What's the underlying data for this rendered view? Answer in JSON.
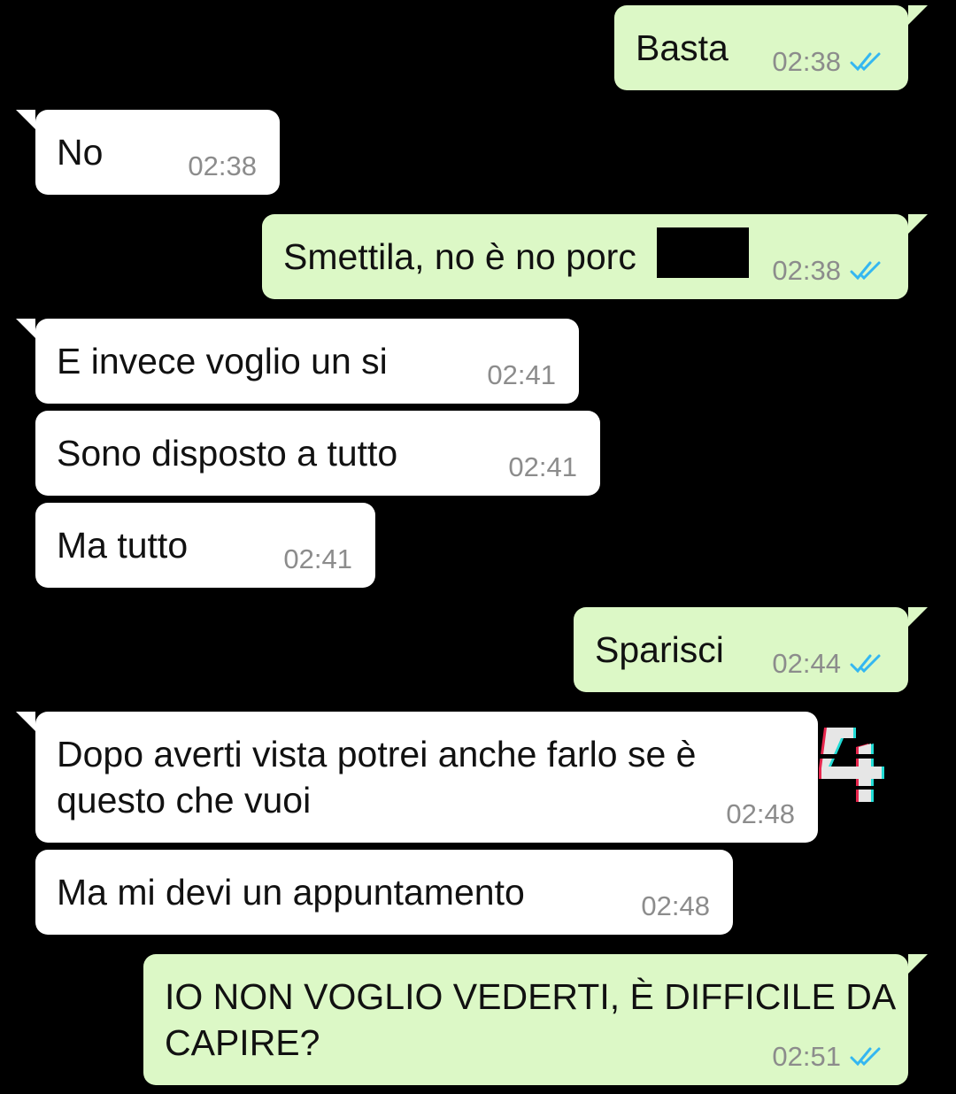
{
  "colors": {
    "background": "#000000",
    "outgoing_bubble": "#dcf8c6",
    "incoming_bubble": "#ffffff",
    "read_tick": "#34b7f1",
    "timestamp": "#8c8c8c"
  },
  "messages": [
    {
      "direction": "outgoing",
      "text": "Basta",
      "time": "02:38",
      "status_icon": "double-check-read-icon"
    },
    {
      "direction": "incoming",
      "text": "No",
      "time": "02:38"
    },
    {
      "direction": "outgoing",
      "text": "Smettila, no è no porc",
      "time": "02:38",
      "status_icon": "double-check-read-icon",
      "redacted": true
    },
    {
      "direction": "incoming",
      "text": "E invece voglio un si",
      "time": "02:41"
    },
    {
      "direction": "incoming",
      "text": "Sono disposto a tutto",
      "time": "02:41"
    },
    {
      "direction": "incoming",
      "text": "Ma tutto",
      "time": "02:41"
    },
    {
      "direction": "outgoing",
      "text": "Sparisci",
      "time": "02:44",
      "status_icon": "double-check-read-icon"
    },
    {
      "direction": "incoming",
      "text": "Dopo averti vista potrei anche farlo se è\nquesto che vuoi",
      "time": "02:48"
    },
    {
      "direction": "incoming",
      "text": "Ma mi devi un appuntamento",
      "time": "02:48"
    },
    {
      "direction": "outgoing",
      "text": "IO NON VOGLIO VEDERTI, È DIFFICILE DA\nCAPIRE?",
      "time": "02:51",
      "status_icon": "double-check-read-icon"
    }
  ],
  "overlay": {
    "sticker_icon": "glitch-watermark-icon"
  }
}
